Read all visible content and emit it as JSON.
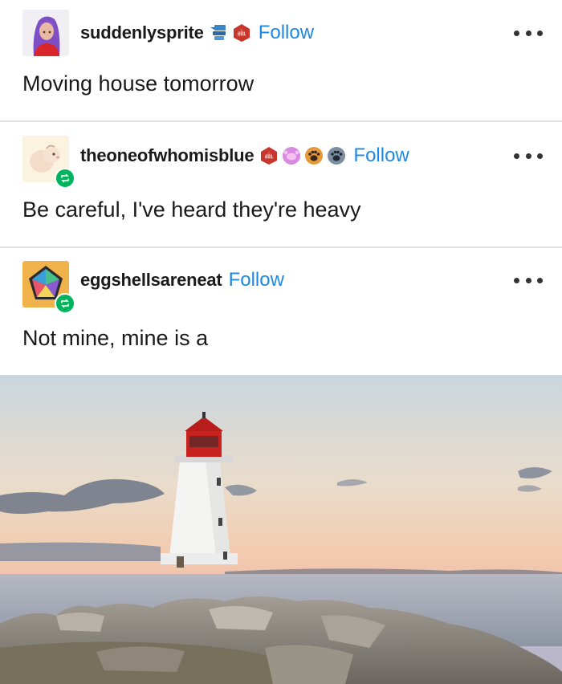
{
  "posts": [
    {
      "username": "suddenlysprite",
      "follow_label": "Follow",
      "text": "Moving house tomorrow",
      "badges": [
        "bird-pet-badge",
        "d20-die-badge"
      ]
    },
    {
      "username": "theoneofwhomisblue",
      "follow_label": "Follow",
      "text": "Be careful, I've heard they're heavy",
      "badges": [
        "d20-die-badge",
        "crab-badge",
        "paw-print-badge",
        "paw-print-badge"
      ]
    },
    {
      "username": "eggshellsareneat",
      "follow_label": "Follow",
      "text": "Not mine, mine is a",
      "badges": []
    }
  ],
  "image": {
    "subject": "lighthouse-photo"
  },
  "colors": {
    "follow": "#1e88e5",
    "reblog_badge": "#00b35c",
    "divider": "#e2e2e2"
  }
}
